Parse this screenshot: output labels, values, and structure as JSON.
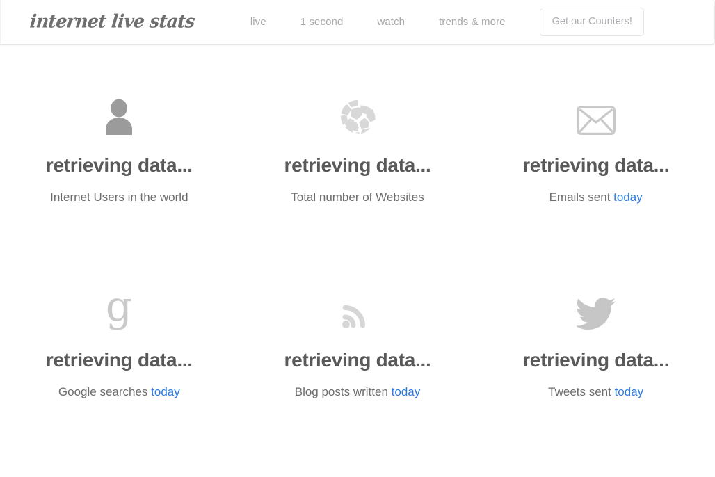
{
  "colors": {
    "page_bg": "#ffffff",
    "header_bg": "#ffffff",
    "logo_text": "#6e6e6e",
    "nav_text": "#a8a8ac",
    "counter_value_text": "#595959",
    "counter_label_text": "#6d6d6d",
    "link_blue": "#2a7ae2",
    "icon_dark_grey": "#9b9b9b",
    "icon_light_grey": "#d8d8d8",
    "border_grey": "#e4e4e8"
  },
  "header": {
    "logo_text": "internet live stats",
    "nav": [
      {
        "label": "live",
        "name": "nav-item-live"
      },
      {
        "label": "1 second",
        "name": "nav-item-1-second"
      },
      {
        "label": "watch",
        "name": "nav-item-watch"
      },
      {
        "label": "trends & more",
        "name": "nav-item-trends-and-more"
      }
    ],
    "cta_button_label": "Get our Counters!"
  },
  "counters": [
    {
      "icon": "user-silhouette-icon",
      "value": "retrieving data...",
      "label_prefix": "Internet Users in the world",
      "label_link": "",
      "label_suffix": ""
    },
    {
      "icon": "globe-sphere-icon",
      "value": "retrieving data...",
      "label_prefix": "Total number of Websites",
      "label_link": "",
      "label_suffix": ""
    },
    {
      "icon": "envelope-icon",
      "value": "retrieving data...",
      "label_prefix": "Emails sent ",
      "label_link": "today",
      "label_suffix": ""
    },
    {
      "icon": "google-g-icon",
      "value": "retrieving data...",
      "label_prefix": "Google searches ",
      "label_link": "today",
      "label_suffix": ""
    },
    {
      "icon": "rss-feed-icon",
      "value": "retrieving data...",
      "label_prefix": "Blog posts written ",
      "label_link": "today",
      "label_suffix": ""
    },
    {
      "icon": "twitter-bird-icon",
      "value": "retrieving data...",
      "label_prefix": "Tweets sent ",
      "label_link": "today",
      "label_suffix": ""
    }
  ]
}
